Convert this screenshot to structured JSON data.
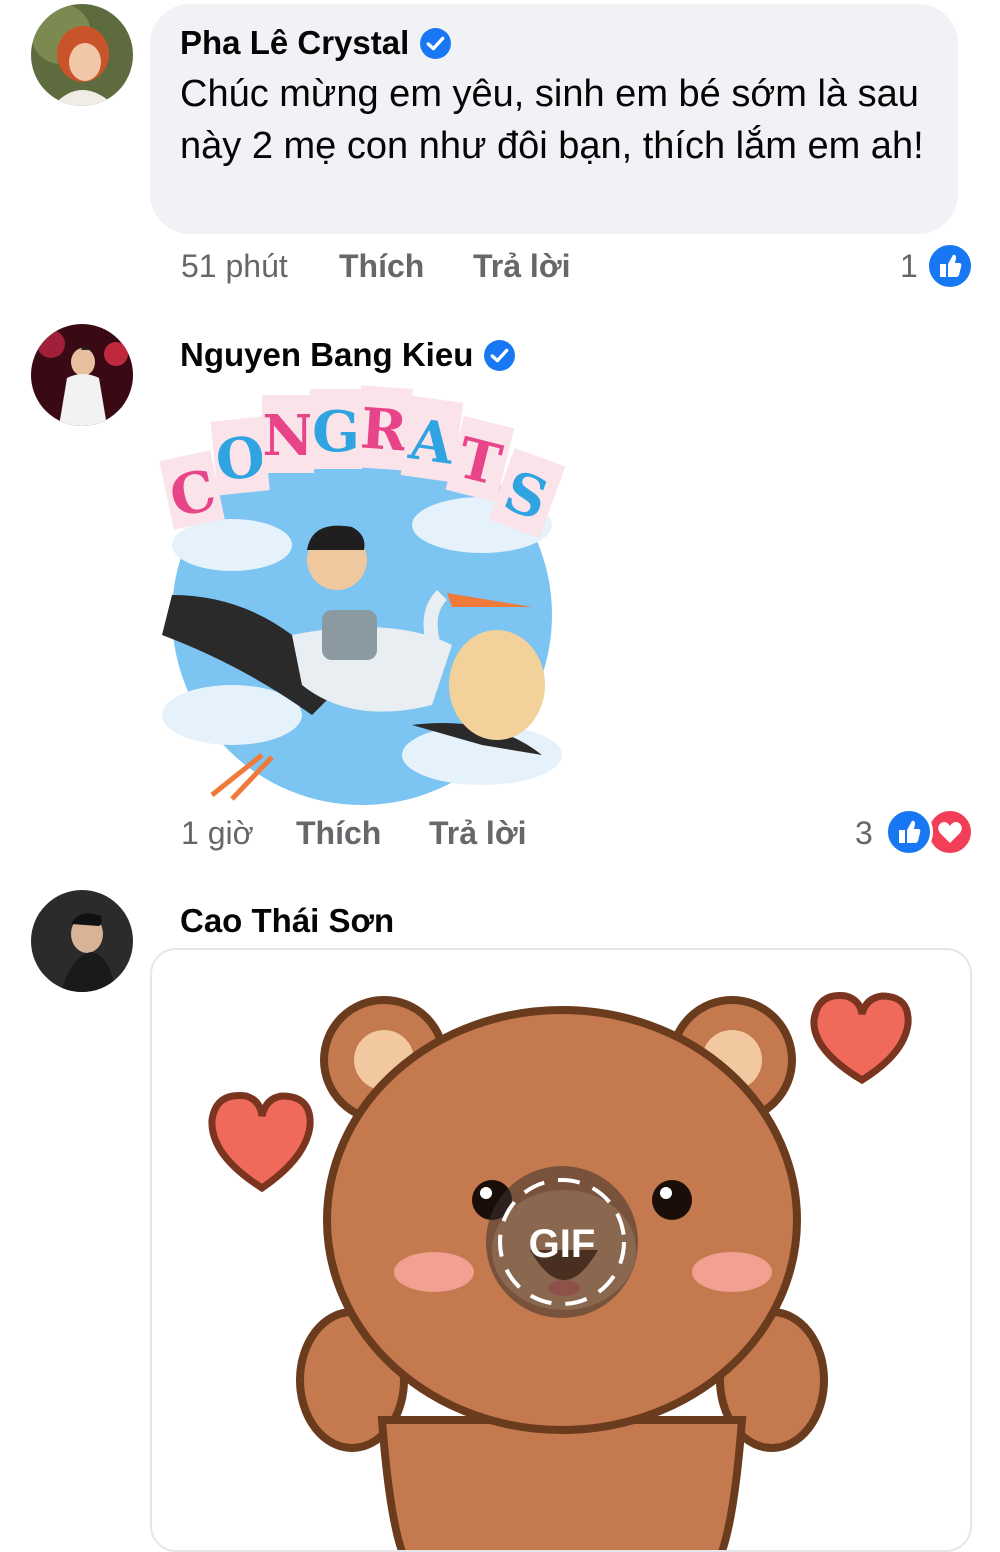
{
  "comments": [
    {
      "author": "Pha Lê Crystal",
      "verified": true,
      "text": "Chúc mừng em yêu, sinh em bé sớm là sau này 2 mẹ con như đôi bạn, thích lắm em ah!",
      "time": "51 phút",
      "like_label": "Thích",
      "reply_label": "Trả lời",
      "reaction_count": "1",
      "reactions": [
        "like-icon"
      ]
    },
    {
      "author": "Nguyen Bang Kieu",
      "verified": true,
      "sticker_text": "CONGRATS",
      "time": "1 giờ",
      "like_label": "Thích",
      "reply_label": "Trả lời",
      "reaction_count": "3",
      "reactions": [
        "like-icon",
        "love-icon"
      ]
    },
    {
      "author": "Cao Thái Sơn",
      "verified": false,
      "gif_badge": "GIF"
    }
  ],
  "colors": {
    "accent_blue": "#1877f2",
    "love_red": "#f33e58",
    "bubble_gray": "#f0f2f5",
    "meta_gray": "#65676b"
  }
}
